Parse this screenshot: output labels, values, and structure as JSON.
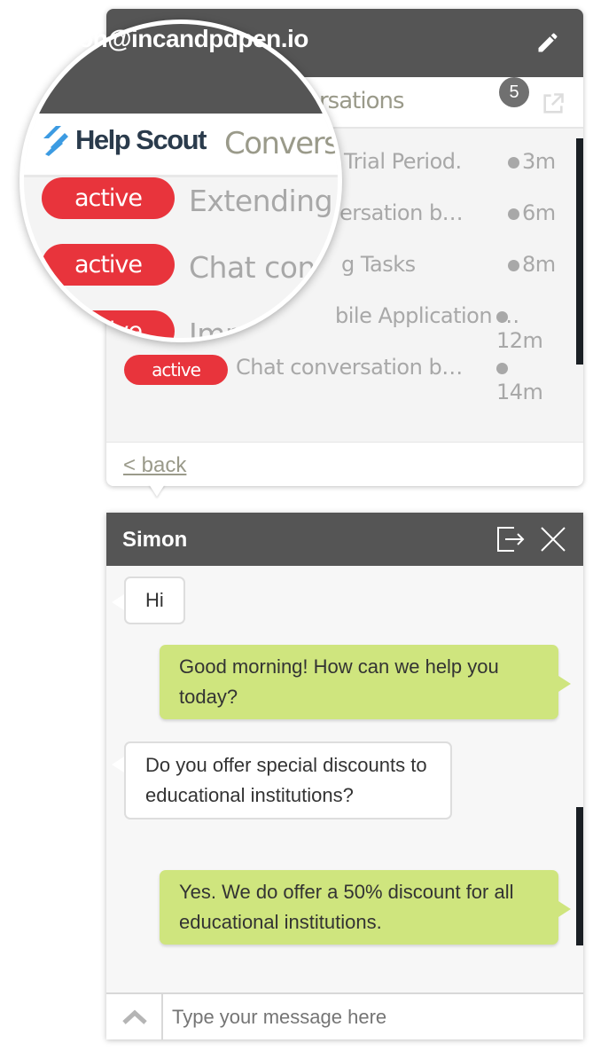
{
  "header": {
    "email": "on@incandpdpen.io",
    "edit_icon": "pencil-icon"
  },
  "subheader": {
    "logo": "Help Scout",
    "title_fragment": "ersations",
    "magnified_title": "Convers",
    "count": "5",
    "external_icon": "external-link-icon"
  },
  "conversations": [
    {
      "status": "active",
      "title": "Trial Period.",
      "magnified_title": "Extending T",
      "time": "3m"
    },
    {
      "status": "active",
      "title": "ersation b…",
      "magnified_title": "Chat conv",
      "time": "6m"
    },
    {
      "status": "active",
      "title": "g Tasks",
      "magnified_title": "Imp",
      "time": "8m"
    },
    {
      "status": "active",
      "title": "bile Application …",
      "time": "12m"
    },
    {
      "status": "active",
      "title": "Chat conversation b…",
      "time": "14m"
    }
  ],
  "footer": {
    "back": "< back"
  },
  "chat": {
    "name": "Simon",
    "messages": [
      {
        "from": "visitor",
        "text": "Hi"
      },
      {
        "from": "agent",
        "text": "Good morning! How can we help you today?"
      },
      {
        "from": "visitor",
        "text": "Do you offer special discounts to educational institutions?"
      },
      {
        "from": "agent",
        "text": "Yes. We do offer a 50% discount for all educational institutions."
      }
    ],
    "input_placeholder": "Type your message here"
  },
  "colors": {
    "header": "#555555",
    "active_badge": "#e8343c",
    "agent_bubble": "#cfe57e"
  }
}
